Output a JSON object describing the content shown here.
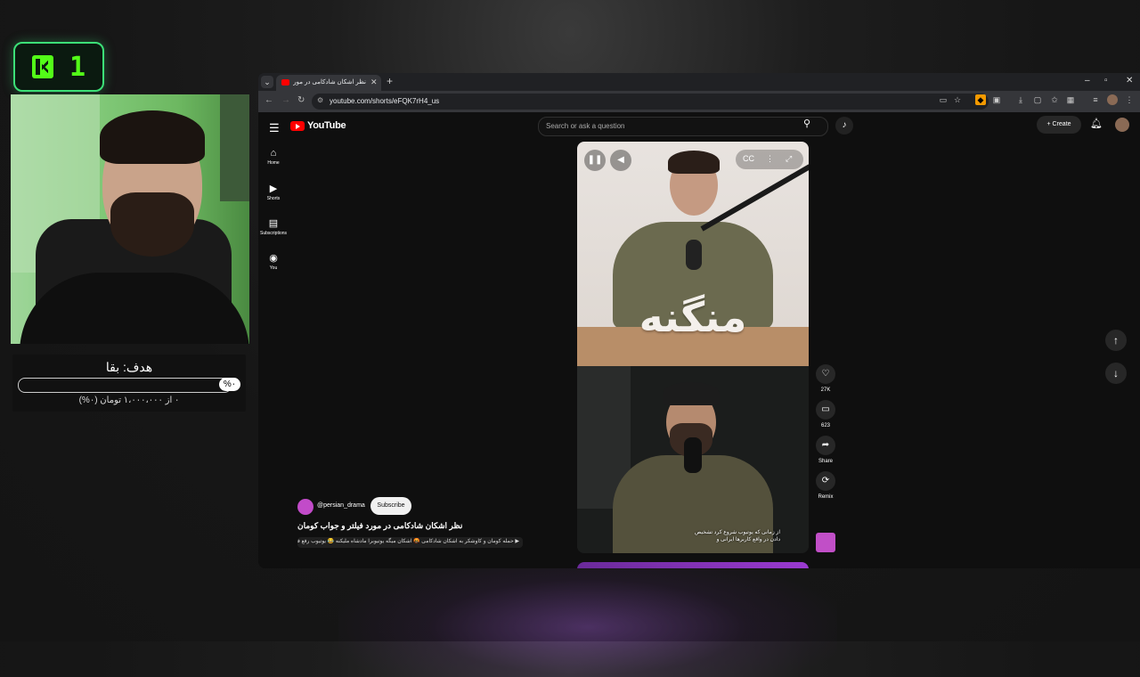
{
  "overlay": {
    "logo_number": "1",
    "goal_title": "هدف: بقا",
    "goal_percent": "%۰",
    "goal_progress": 0,
    "goal_sub": "۰ از ۱،۰۰۰،۰۰۰ تومان (۰%)"
  },
  "browser": {
    "tab_title": "نظر اشکان شادکامی در مورد...",
    "url": "youtube.com/shorts/eFQK7rH4_us"
  },
  "youtube": {
    "logo_text": "YouTube",
    "search_placeholder": "Search or ask a question",
    "create_label": "Create",
    "sidebar": [
      {
        "icon": "⌂",
        "label": "Home"
      },
      {
        "icon": "▶",
        "label": "Shorts"
      },
      {
        "icon": "▤",
        "label": "Subscriptions"
      },
      {
        "icon": "◉",
        "label": "You"
      }
    ],
    "short": {
      "video_brand_text": "منگنه",
      "subtitle_text": "از زمانی که یوتیوب شروع کرد تشخیص دادن در واقع کاربرها ایرانی و",
      "channel": "@persian_drama",
      "subscribe_label": "Subscribe",
      "title": "نظر اشکان شادکامی در مورد فیلتر و جواب کومان",
      "description": "▶ حمله کومان و کاوشکر به اشکان شادکامی 🤬 اشکان میگه یوتیوبرا مادشاه ملیکنه 😂 یوتیوب رفع فیلتر شد؟"
    },
    "actions": [
      {
        "icon": "♡",
        "label": "27K"
      },
      {
        "icon": "▭",
        "label": "623"
      },
      {
        "icon": "➦",
        "label": "Share"
      },
      {
        "icon": "⟳",
        "label": "Remix"
      }
    ]
  },
  "colors": {
    "kick_green": "#53fc18",
    "yt_red": "#ff0000",
    "bg": "#0f0f0f"
  }
}
